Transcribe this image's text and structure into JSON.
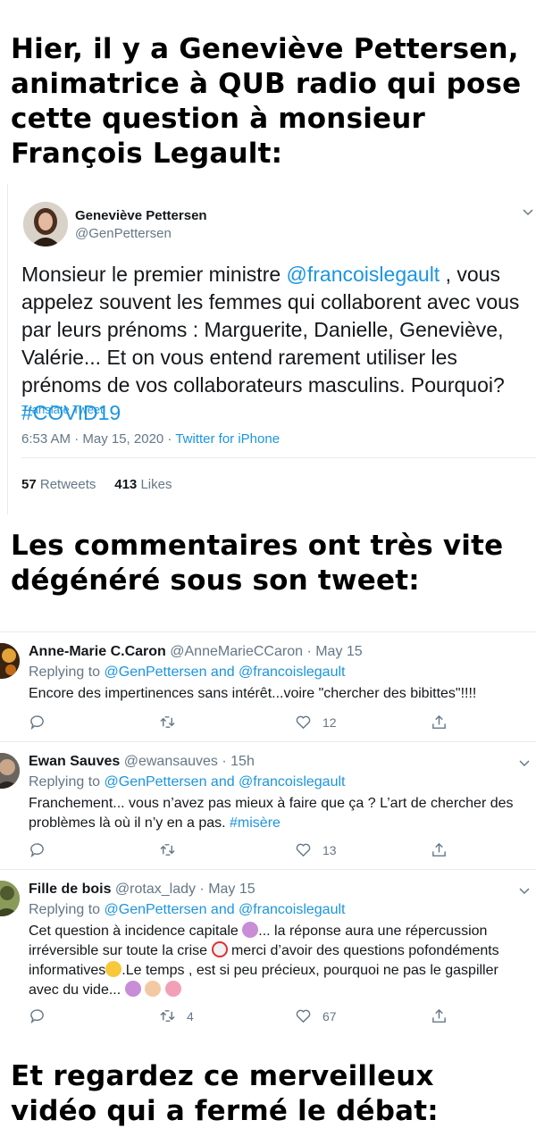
{
  "captions": {
    "top": "Hier, il y a Geneviève Pettersen, animatrice à QUB radio qui pose cette question à monsieur François Legault:",
    "middle": "Les commentaires ont très vite dégénéré sous son tweet:",
    "bottom": "Et regardez ce merveilleux vidéo qui a fermé le débat:"
  },
  "main_tweet": {
    "name": "Geneviève Pettersen",
    "handle": "@GenPettersen",
    "text_part1": "Monsieur le premier ministre ",
    "mention": "@francoislegault",
    "text_part2": " , vous appelez souvent les femmes qui collaborent avec vous par leurs prénoms : Marguerite, Danielle, Geneviève, Valérie... Et on vous entend rarement utiliser les prénoms de vos collaborateurs masculins. Pourquoi? ",
    "hashtag": "#COVID19",
    "translate": "Translate Tweet",
    "time": "6:53 AM · May 15, 2020",
    "sep": " · ",
    "source": "Twitter for iPhone",
    "retweets_count": "57",
    "retweets_label": "Retweets",
    "likes_count": "413",
    "likes_label": "Likes"
  },
  "replies": [
    {
      "name": "Anne-Marie C.Caron",
      "handle": "@AnneMarieCCaron · May 15",
      "replying_prefix": "Replying to ",
      "replying_to": "@GenPettersen and @francoislegault",
      "text": "Encore des impertinences sans intérêt...voire \"chercher des bibittes\"!!!!",
      "likes": "12"
    },
    {
      "name": "Ewan Sauves",
      "handle": "@ewansauves · 15h",
      "replying_prefix": "Replying to ",
      "replying_to": "@GenPettersen and @francoislegault",
      "text": "Franchement... vous n’avez pas mieux à faire que ça ? L’art de chercher des problèmes là où il n’y en a pas. ",
      "hashtag": "#misère",
      "likes": "13"
    },
    {
      "name": "Fille de bois",
      "handle": "@rotax_lady · May 15",
      "replying_prefix": "Replying to ",
      "replying_to": "@GenPettersen and @francoislegault",
      "text1": "Cet question à incidence capitale ",
      "text2": "... la réponse aura une répercussion irréversible sur toute la crise ",
      "text3": " merci d’avoir des questions pofondéments informatives",
      "text4": ".Le temps , est si peu précieux, pourquoi ne pas le gaspiller avec du vide... ",
      "retweets": "4",
      "likes": "67"
    }
  ],
  "colors": {
    "link": "#1b95e0",
    "muted": "#657786",
    "text": "#14171a",
    "border": "#e6ecf0"
  }
}
